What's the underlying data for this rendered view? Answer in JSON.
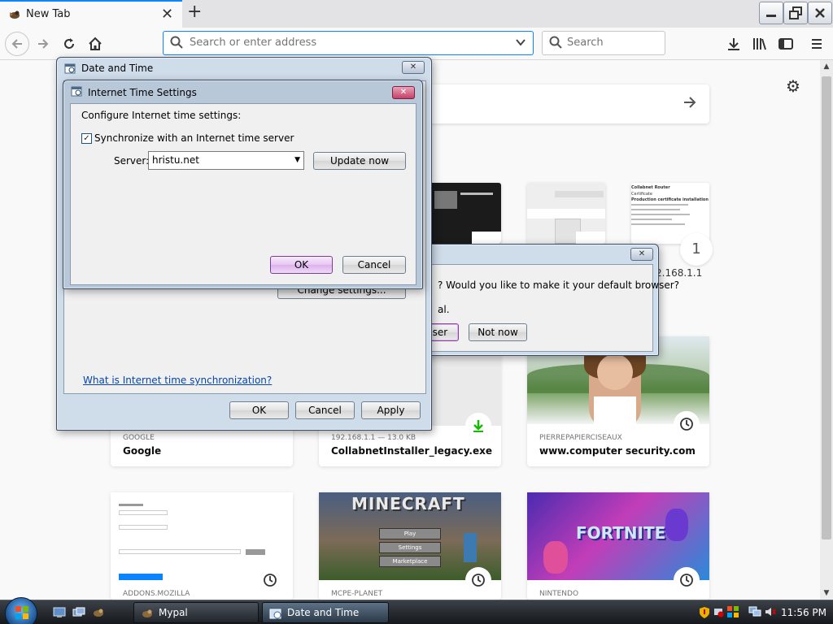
{
  "browser": {
    "tab": {
      "title": "New Tab"
    },
    "urlbar": {
      "placeholder": "Search or enter address"
    },
    "searchbar": {
      "placeholder": "Search"
    }
  },
  "newtab": {
    "partial_tiles": {
      "badge_number": "1",
      "ip_label": "2.168.1.1",
      "collabnet_preview": [
        "Collabnet Router",
        "Certificate",
        "Production certificate installation"
      ]
    },
    "top_sites": [
      {
        "source": "GOOGLE",
        "name": "Google",
        "badge": "none"
      },
      {
        "source": "192.168.1.1 — 13.0 KB",
        "name": "CollabnetInstaller_legacy.exe",
        "badge": "download-icon"
      },
      {
        "source": "PIERREPAPIERCISEAUX",
        "name": "www.computer security.com",
        "badge": "clock-icon"
      }
    ],
    "bottom_sites": [
      {
        "source": "ADDONS.MOZILLA",
        "badge": "clock-icon"
      },
      {
        "source": "MCPE-PLANET",
        "badge": "clock-icon",
        "preview_title": "MINECRAFT",
        "preview_buttons": [
          "Play",
          "Settings",
          "Marketplace"
        ]
      },
      {
        "source": "NINTENDO",
        "badge": "clock-icon",
        "preview_title": "FORTNITE"
      }
    ]
  },
  "default_browser_prompt": {
    "message": "? Would you like to make it your default browser?",
    "message2": "al.",
    "yes_label": "wser",
    "no_label": "Not now"
  },
  "date_time_dialog": {
    "title": "Date and Time",
    "change_settings_label": "Change settings...",
    "help_link": "What is Internet time synchronization?",
    "ok_label": "OK",
    "cancel_label": "Cancel",
    "apply_label": "Apply"
  },
  "internet_time_dialog": {
    "title": "Internet Time Settings",
    "heading": "Configure Internet time settings:",
    "sync_label": "Synchronize with an Internet time server",
    "sync_checked": true,
    "server_label": "Server:",
    "server_value": "hristu.net",
    "update_label": "Update now",
    "ok_label": "OK",
    "cancel_label": "Cancel"
  },
  "taskbar": {
    "buttons": [
      {
        "label": "Mypal",
        "icon": "mypal-icon",
        "active": false
      },
      {
        "label": "Date and Time",
        "icon": "clock-window-icon",
        "active": true
      }
    ],
    "clock": "11:56 PM"
  },
  "colors": {
    "accent": "#0a84ff",
    "dialog_frame": "#cfdcea",
    "taskbar": "#1b1f24",
    "default_button": "#e7c6f2"
  }
}
